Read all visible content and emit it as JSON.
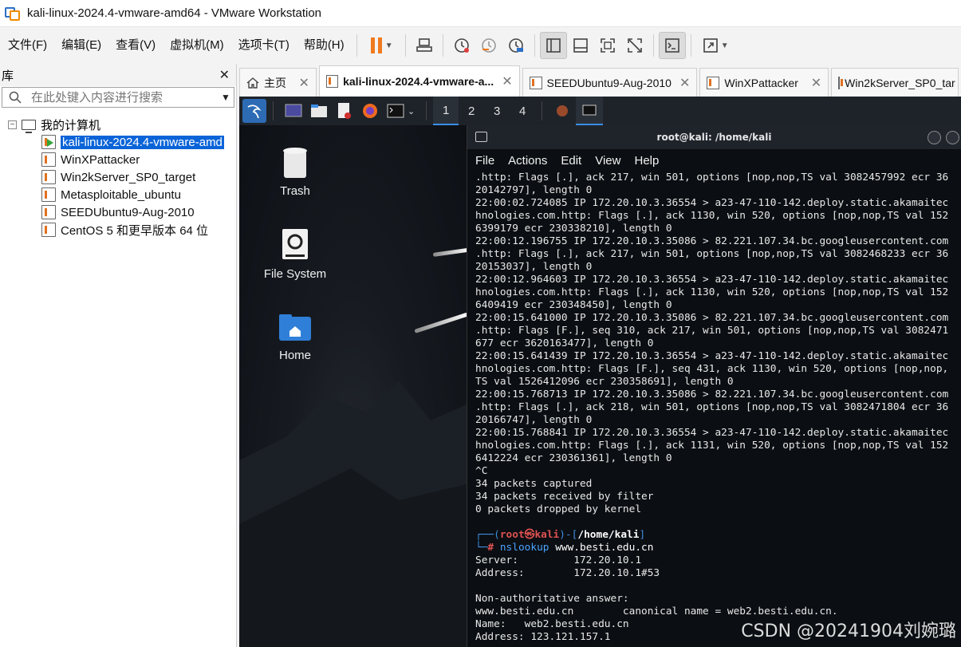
{
  "window": {
    "title": "kali-linux-2024.4-vmware-amd64 - VMware Workstation"
  },
  "menu": [
    "文件(F)",
    "编辑(E)",
    "查看(V)",
    "虚拟机(M)",
    "选项卡(T)",
    "帮助(H)"
  ],
  "library": {
    "title": "库",
    "search_placeholder": "在此处键入内容进行搜索",
    "root": "我的计算机",
    "items": [
      {
        "label": "kali-linux-2024.4-vmware-amd",
        "selected": true,
        "running": true
      },
      {
        "label": "WinXPattacker"
      },
      {
        "label": "Win2kServer_SP0_target"
      },
      {
        "label": "Metasploitable_ubuntu"
      },
      {
        "label": "SEEDUbuntu9-Aug-2010"
      },
      {
        "label": "CentOS 5 和更早版本 64 位"
      }
    ]
  },
  "tabs": [
    {
      "label": "主页",
      "icon": "home-icon"
    },
    {
      "label": "kali-linux-2024.4-vmware-a...",
      "active": true
    },
    {
      "label": "SEEDUbuntu9-Aug-2010"
    },
    {
      "label": "WinXPattacker"
    },
    {
      "label": "Win2kServer_SP0_tar"
    }
  ],
  "kali": {
    "workspaces": [
      "1",
      "2",
      "3",
      "4"
    ],
    "active_workspace": "1",
    "desktop_icons": [
      {
        "label": "Trash",
        "icon": "trash-icon"
      },
      {
        "label": "File System",
        "icon": "drive-icon"
      },
      {
        "label": "Home",
        "icon": "home-folder-icon"
      }
    ]
  },
  "terminal": {
    "title": "root@kali: /home/kali",
    "menu": [
      "File",
      "Actions",
      "Edit",
      "View",
      "Help"
    ],
    "lines": [
      ".http: Flags [.], ack 217, win 501, options [nop,nop,TS val 3082457992 ecr 36",
      "20142797], length 0",
      "22:00:02.724085 IP 172.20.10.3.36554 > a23-47-110-142.deploy.static.akamaitec",
      "hnologies.com.http: Flags [.], ack 1130, win 520, options [nop,nop,TS val 152",
      "6399179 ecr 230338210], length 0",
      "22:00:12.196755 IP 172.20.10.3.35086 > 82.221.107.34.bc.googleusercontent.com",
      ".http: Flags [.], ack 217, win 501, options [nop,nop,TS val 3082468233 ecr 36",
      "20153037], length 0",
      "22:00:12.964603 IP 172.20.10.3.36554 > a23-47-110-142.deploy.static.akamaitec",
      "hnologies.com.http: Flags [.], ack 1130, win 520, options [nop,nop,TS val 152",
      "6409419 ecr 230348450], length 0",
      "22:00:15.641000 IP 172.20.10.3.35086 > 82.221.107.34.bc.googleusercontent.com",
      ".http: Flags [F.], seq 310, ack 217, win 501, options [nop,nop,TS val 3082471",
      "677 ecr 3620163477], length 0",
      "22:00:15.641439 IP 172.20.10.3.36554 > a23-47-110-142.deploy.static.akamaitec",
      "hnologies.com.http: Flags [F.], seq 431, ack 1130, win 520, options [nop,nop,",
      "TS val 1526412096 ecr 230358691], length 0",
      "22:00:15.768713 IP 172.20.10.3.35086 > 82.221.107.34.bc.googleusercontent.com",
      ".http: Flags [.], ack 218, win 501, options [nop,nop,TS val 3082471804 ecr 36",
      "20166747], length 0",
      "22:00:15.768841 IP 172.20.10.3.36554 > a23-47-110-142.deploy.static.akamaitec",
      "hnologies.com.http: Flags [.], ack 1131, win 520, options [nop,nop,TS val 152",
      "6412224 ecr 230361361], length 0",
      "^C",
      "34 packets captured",
      "34 packets received by filter",
      "0 packets dropped by kernel",
      ""
    ],
    "prompt": {
      "frame_start": "┌──(",
      "user": "root㉿kali",
      "frame_mid": ")-[",
      "dir": "/home/kali",
      "frame_end": "]",
      "frame2": "└─",
      "hash": "# ",
      "cmd": "nslookup",
      "arg": " www.besti.edu.cn"
    },
    "output": [
      "Server:         172.20.10.1",
      "Address:        172.20.10.1#53",
      "",
      "Non-authoritative answer:",
      "www.besti.edu.cn        canonical name = web2.besti.edu.cn.",
      "Name:   web2.besti.edu.cn",
      "Address: 123.121.157.1"
    ]
  },
  "watermark": "CSDN @20241904刘婉璐"
}
